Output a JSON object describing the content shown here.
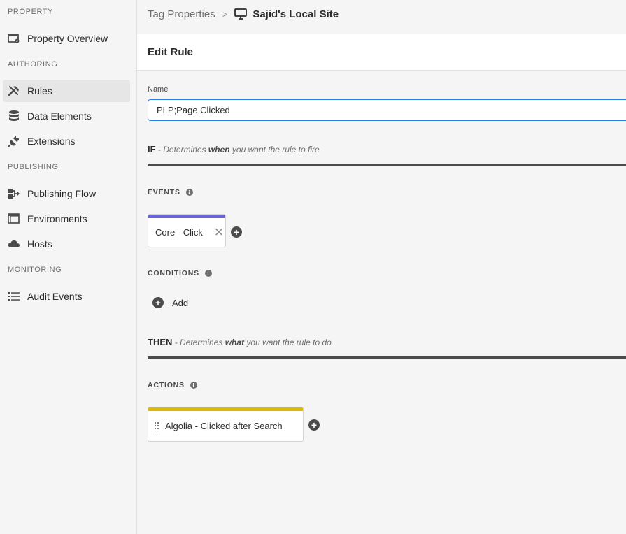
{
  "sidebar": {
    "sections": {
      "property": "PROPERTY",
      "authoring": "AUTHORING",
      "publishing": "PUBLISHING",
      "monitoring": "MONITORING"
    },
    "items": {
      "property_overview": "Property Overview",
      "rules": "Rules",
      "data_elements": "Data Elements",
      "extensions": "Extensions",
      "publishing_flow": "Publishing Flow",
      "environments": "Environments",
      "hosts": "Hosts",
      "audit_events": "Audit Events"
    }
  },
  "header": {
    "breadcrumb_root": "Tag Properties",
    "breadcrumb_sep": ">",
    "site_name": "Sajid's Local Site"
  },
  "page": {
    "title": "Edit Rule"
  },
  "form": {
    "name_label": "Name",
    "name_value": "PLP;Page Clicked"
  },
  "if_section": {
    "keyword": "IF",
    "desc_pre": " - Determines ",
    "desc_bold": "when",
    "desc_post": " you want the rule to fire"
  },
  "events": {
    "label": "EVENTS",
    "card_label": "Core - Click",
    "accent": "#6c63e0"
  },
  "conditions": {
    "label": "CONDITIONS",
    "add_label": "Add"
  },
  "then_section": {
    "keyword": "THEN",
    "desc_pre": " - Determines ",
    "desc_bold": "what",
    "desc_post": " you want the rule to do"
  },
  "actions": {
    "label": "ACTIONS",
    "card_label": "Algolia - Clicked after Search",
    "accent": "#e0b800"
  },
  "icons": {
    "info": "i",
    "close": "✕",
    "plus": "+"
  }
}
